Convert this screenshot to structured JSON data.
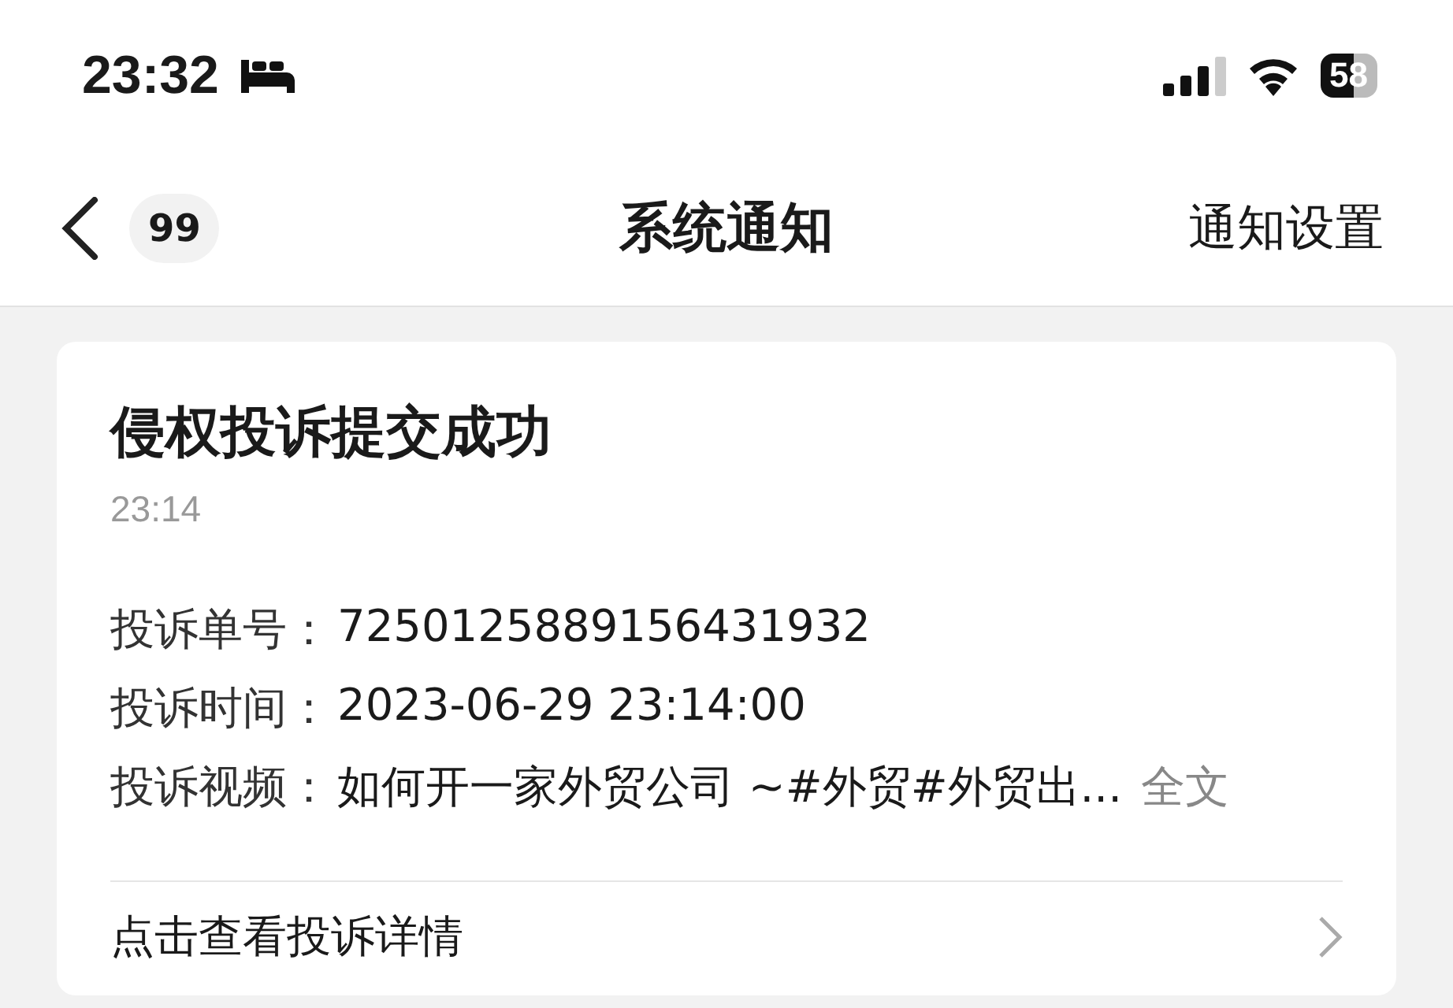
{
  "status_bar": {
    "time": "23:32",
    "battery": "58"
  },
  "nav_bar": {
    "badge": "99",
    "title": "系统通知",
    "action": "通知设置"
  },
  "card": {
    "title": "侵权投诉提交成功",
    "time": "23:14",
    "fields": [
      {
        "label": "投诉单号：",
        "value": "7250125889156431932"
      },
      {
        "label": "投诉时间：",
        "value": "2023-06-29 23:14:00"
      },
      {
        "label": "投诉视频：",
        "value": "如何开一家外贸公司 ~#外贸#外贸出...",
        "more": "全文"
      }
    ],
    "link": "点击查看投诉详情"
  }
}
